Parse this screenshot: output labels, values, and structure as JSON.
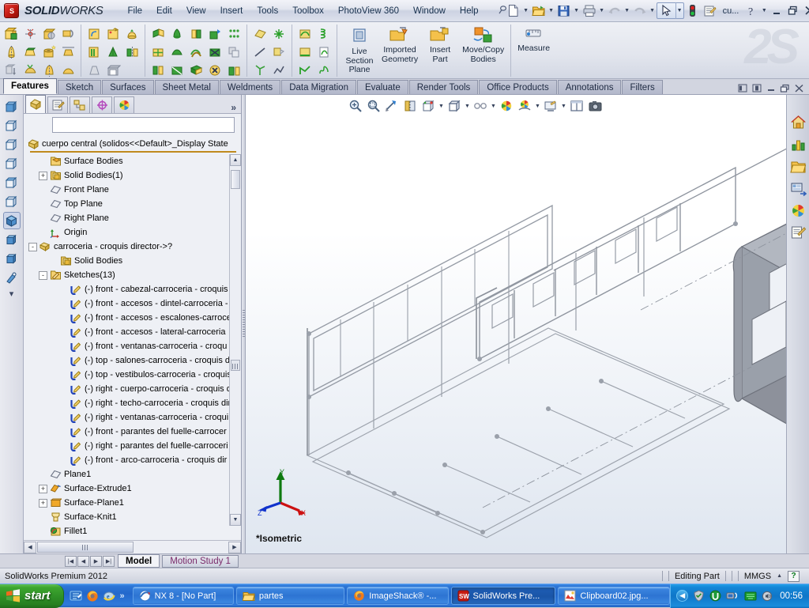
{
  "app": {
    "brand_main": "SOLID",
    "brand_light": "WORKS",
    "cube_text": "S",
    "status_text": "SolidWorks Premium 2012",
    "editing_state": "Editing Part",
    "unit_system": "MMGS",
    "accent_color": "#c01810",
    "tree_root_color": "#c08a1e"
  },
  "menu": {
    "items": [
      {
        "label": "File"
      },
      {
        "label": "Edit"
      },
      {
        "label": "View"
      },
      {
        "label": "Insert"
      },
      {
        "label": "Tools"
      },
      {
        "label": "Toolbox"
      },
      {
        "label": "PhotoView 360"
      },
      {
        "label": "Window"
      },
      {
        "label": "Help"
      }
    ],
    "pin_icon": "pushpin-icon"
  },
  "titlebar_tools": {
    "new_icon": "new-document-icon",
    "open_icon": "open-folder-icon",
    "save_icon": "save-disk-icon",
    "print_icon": "print-icon",
    "undo_icon": "undo-arrow-icon",
    "redo_icon": "redo-arrow-icon",
    "select_icon": "select-cursor-icon",
    "rebuild_icon": "rebuild-traffic-light-icon",
    "options_icon": "options-icon",
    "search_value": "cu...",
    "help_icon": "help-question-icon",
    "minimize_icon": "minimize-icon",
    "restore_icon": "restore-icon",
    "close_icon": "close-icon"
  },
  "ribbon": {
    "big_buttons": [
      {
        "label": "Live\nSection\nPlane",
        "icon": "live-section-plane-icon"
      },
      {
        "label": "Imported\nGeometry",
        "icon": "imported-geometry-icon"
      },
      {
        "label": "Insert\nPart",
        "icon": "insert-part-icon"
      },
      {
        "label": "Move/Copy\nBodies",
        "icon": "move-copy-bodies-icon"
      },
      {
        "label": "Measure",
        "icon": "measure-icon"
      }
    ],
    "watermark": "2S"
  },
  "tabs": {
    "items": [
      {
        "label": "Features",
        "active": true
      },
      {
        "label": "Sketch",
        "active": false
      },
      {
        "label": "Surfaces",
        "active": false
      },
      {
        "label": "Sheet Metal",
        "active": false
      },
      {
        "label": "Weldments",
        "active": false
      },
      {
        "label": "Data Migration",
        "active": false
      },
      {
        "label": "Evaluate",
        "active": false
      },
      {
        "label": "Render Tools",
        "active": false
      },
      {
        "label": "Office Products",
        "active": false
      },
      {
        "label": "Annotations",
        "active": false
      },
      {
        "label": "Filters",
        "active": false
      }
    ]
  },
  "doc_window_controls": {
    "tile_left_icon": "dock-left-icon",
    "tile_right_icon": "dock-right-icon",
    "minimize_icon": "minimize-icon",
    "restore_icon": "restore-icon",
    "close_icon": "close-icon"
  },
  "feature_manager": {
    "tabs": [
      {
        "name": "feature-tree-tab",
        "icon": "feature-tree-icon",
        "active": true
      },
      {
        "name": "property-manager-tab",
        "icon": "property-manager-icon",
        "active": false
      },
      {
        "name": "configuration-manager-tab",
        "icon": "configuration-manager-icon",
        "active": false
      },
      {
        "name": "dimxpert-manager-tab",
        "icon": "dimxpert-icon",
        "active": false
      },
      {
        "name": "display-manager-tab",
        "icon": "appearances-sphere-icon",
        "active": false
      }
    ],
    "more_label": "»",
    "root": "cuerpo central  (solidos<<Default>_Display State",
    "tree": [
      {
        "label": "Surface Bodies",
        "indent": 1,
        "expander": "",
        "icon": "surface-bodies-folder-icon"
      },
      {
        "label": "Solid Bodies(1)",
        "indent": 1,
        "expander": "+",
        "icon": "solid-bodies-folder-icon"
      },
      {
        "label": "Front Plane",
        "indent": 1,
        "expander": "",
        "icon": "plane-icon"
      },
      {
        "label": "Top Plane",
        "indent": 1,
        "expander": "",
        "icon": "plane-icon"
      },
      {
        "label": "Right Plane",
        "indent": 1,
        "expander": "",
        "icon": "plane-icon"
      },
      {
        "label": "Origin",
        "indent": 1,
        "expander": "",
        "icon": "origin-icon"
      },
      {
        "label": "carroceria - croquis director->?",
        "indent": 0,
        "expander": "-",
        "icon": "imported-body-icon"
      },
      {
        "label": "Solid Bodies",
        "indent": 2,
        "expander": "",
        "icon": "solid-bodies-folder-icon"
      },
      {
        "label": "Sketches(13)",
        "indent": 1,
        "expander": "-",
        "icon": "sketch-folder-icon"
      },
      {
        "label": "(-) front - cabezal-carroceria - croquis",
        "indent": 3,
        "expander": "",
        "icon": "sketch-icon"
      },
      {
        "label": "(-) front - accesos - dintel-carroceria -",
        "indent": 3,
        "expander": "",
        "icon": "sketch-icon"
      },
      {
        "label": "(-) front - accesos - escalones-carroce",
        "indent": 3,
        "expander": "",
        "icon": "sketch-icon"
      },
      {
        "label": "(-) front - accesos - lateral-carroceria",
        "indent": 3,
        "expander": "",
        "icon": "sketch-icon"
      },
      {
        "label": "(-) front - ventanas-carroceria - croqu",
        "indent": 3,
        "expander": "",
        "icon": "sketch-icon"
      },
      {
        "label": "(-) top - salones-carroceria - croquis d",
        "indent": 3,
        "expander": "",
        "icon": "sketch-icon"
      },
      {
        "label": "(-) top - vestibulos-carroceria - croquis",
        "indent": 3,
        "expander": "",
        "icon": "sketch-icon"
      },
      {
        "label": "(-) right - cuerpo-carroceria - croquis d",
        "indent": 3,
        "expander": "",
        "icon": "sketch-icon"
      },
      {
        "label": "(-) right - techo-carroceria - croquis dir",
        "indent": 3,
        "expander": "",
        "icon": "sketch-icon"
      },
      {
        "label": "(-) right - ventanas-carroceria - croqui",
        "indent": 3,
        "expander": "",
        "icon": "sketch-icon"
      },
      {
        "label": "(-) front - parantes del fuelle-carrocer",
        "indent": 3,
        "expander": "",
        "icon": "sketch-icon"
      },
      {
        "label": "(-) right - parantes del fuelle-carroceri",
        "indent": 3,
        "expander": "",
        "icon": "sketch-icon"
      },
      {
        "label": "(-) front - arco-carroceria - croquis dir",
        "indent": 3,
        "expander": "",
        "icon": "sketch-icon"
      },
      {
        "label": "Plane1",
        "indent": 1,
        "expander": "",
        "icon": "plane-icon"
      },
      {
        "label": "Surface-Extrude1",
        "indent": 1,
        "expander": "+",
        "icon": "surface-extrude-icon"
      },
      {
        "label": "Surface-Plane1",
        "indent": 1,
        "expander": "+",
        "icon": "surface-plane-icon"
      },
      {
        "label": "Surface-Knit1",
        "indent": 1,
        "expander": "",
        "icon": "surface-knit-icon"
      },
      {
        "label": "Fillet1",
        "indent": 1,
        "expander": "",
        "icon": "fillet-icon"
      }
    ]
  },
  "view_toolbar": {
    "items": [
      {
        "name": "zoom-to-fit-button",
        "icon": "zoom-to-fit-icon",
        "caret": false
      },
      {
        "name": "zoom-to-area-button",
        "icon": "zoom-to-area-icon",
        "caret": false
      },
      {
        "name": "previous-view-button",
        "icon": "previous-view-icon",
        "caret": false
      },
      {
        "name": "section-view-button",
        "icon": "section-view-icon",
        "caret": false
      },
      {
        "name": "view-orientation-button",
        "icon": "view-orientation-icon",
        "caret": true
      },
      {
        "name": "display-style-button",
        "icon": "display-style-cube-icon",
        "caret": true
      },
      {
        "name": "hide-show-items-button",
        "icon": "glasses-icon",
        "caret": true
      },
      {
        "name": "edit-appearance-button",
        "icon": "appearances-sphere-icon",
        "caret": false
      },
      {
        "name": "apply-scene-button",
        "icon": "scene-icon",
        "caret": true
      },
      {
        "name": "view-settings-button",
        "icon": "view-settings-icon",
        "caret": true
      },
      {
        "name": "viewport-layout-button",
        "icon": "viewport-split-icon",
        "caret": false
      },
      {
        "name": "screen-capture-button",
        "icon": "camera-icon",
        "caret": false
      }
    ]
  },
  "viewport": {
    "orientation_label": "*Isometric",
    "triad": {
      "x_label": "X",
      "y_label": "Y",
      "z_label": "Z",
      "x_color": "#cc1111",
      "y_color": "#0f7a10",
      "z_color": "#1133cc"
    },
    "model_color": "#8d919b",
    "sketch_color": "#9aa0aa"
  },
  "left_strip": {
    "items": [
      {
        "name": "view-front-button",
        "icon": "cube-front-icon"
      },
      {
        "name": "view-back-button",
        "icon": "cube-back-icon"
      },
      {
        "name": "view-left-button",
        "icon": "cube-left-icon"
      },
      {
        "name": "view-right-button",
        "icon": "cube-right-icon"
      },
      {
        "name": "view-top-button",
        "icon": "cube-top-icon"
      },
      {
        "name": "view-bottom-button",
        "icon": "cube-bottom-icon"
      },
      {
        "name": "view-isometric-button",
        "icon": "cube-isometric-icon"
      },
      {
        "name": "view-trimetric-button",
        "icon": "cube-trimetric-icon"
      },
      {
        "name": "view-dimetric-button",
        "icon": "cube-dimetric-icon"
      },
      {
        "name": "normal-to-button",
        "icon": "normal-to-icon"
      }
    ]
  },
  "task_pane": {
    "items": [
      {
        "name": "solidworks-resources-button",
        "icon": "home-house-icon"
      },
      {
        "name": "design-library-button",
        "icon": "design-library-icon"
      },
      {
        "name": "file-explorer-button",
        "icon": "folder-icon"
      },
      {
        "name": "view-palette-button",
        "icon": "view-palette-icon"
      },
      {
        "name": "appearances-button",
        "icon": "appearances-sphere-icon"
      },
      {
        "name": "custom-properties-button",
        "icon": "custom-properties-icon"
      }
    ]
  },
  "model_bar": {
    "nav": [
      "|◀",
      "◀",
      "▶",
      "▶|"
    ],
    "tabs": [
      {
        "label": "Model",
        "active": true
      },
      {
        "label": "Motion Study 1",
        "active": false
      }
    ]
  },
  "taskbar": {
    "start_label": "start",
    "quick_launch": [
      {
        "name": "show-desktop-icon",
        "icon": "show-desktop-icon"
      },
      {
        "name": "firefox-icon",
        "icon": "firefox-icon"
      },
      {
        "name": "ie-icon",
        "icon": "internet-explorer-icon"
      }
    ],
    "quick_more": "»",
    "buttons": [
      {
        "label": "NX 8 - [No Part]",
        "icon": "nx-icon",
        "active": false
      },
      {
        "label": "partes",
        "icon": "folder-icon",
        "active": false
      },
      {
        "label": "ImageShack® -...",
        "icon": "firefox-icon",
        "active": false
      },
      {
        "label": "SolidWorks Pre...",
        "icon": "solidworks-icon",
        "active": true
      },
      {
        "label": "Clipboard02.jpg...",
        "icon": "image-icon",
        "active": false
      }
    ],
    "tray": [
      {
        "name": "tray-expand-icon",
        "icon": "tray-chevron-icon"
      },
      {
        "name": "tray-shield-icon",
        "icon": "security-icon"
      },
      {
        "name": "tray-utorrent-icon",
        "icon": "utorrent-icon"
      },
      {
        "name": "tray-network-icon",
        "icon": "network-icon"
      },
      {
        "name": "tray-keyboard-icon",
        "icon": "keyboard-icon"
      },
      {
        "name": "tray-volume-icon",
        "icon": "volume-icon"
      }
    ],
    "clock": "00:56"
  }
}
